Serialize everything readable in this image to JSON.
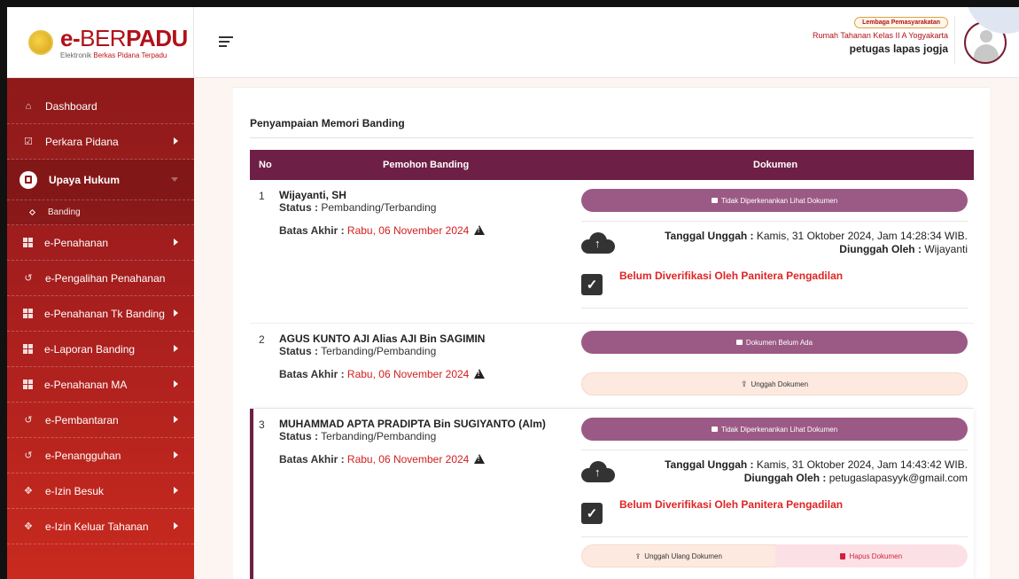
{
  "brand": {
    "name_e": "e-",
    "name_ber": "BER",
    "name_padu": "PADU",
    "subtitle_prefix": "Elektronik",
    "subtitle_red": "Berkas Pidana Terpadu"
  },
  "user": {
    "badge": "Lembaga Pemasyarakatan",
    "org": "Rumah Tahanan Kelas II A Yogyakarta",
    "name": "petugas lapas jogja"
  },
  "sidebar": {
    "items": [
      {
        "label": "Dashboard"
      },
      {
        "label": "Perkara Pidana"
      },
      {
        "label": "Upaya Hukum"
      },
      {
        "label": "Banding"
      },
      {
        "label": "e-Penahanan"
      },
      {
        "label": "e-Pengalihan Penahanan"
      },
      {
        "label": "e-Penahanan Tk Banding"
      },
      {
        "label": "e-Laporan Banding"
      },
      {
        "label": "e-Penahanan MA"
      },
      {
        "label": "e-Pembantaran"
      },
      {
        "label": "e-Penangguhan"
      },
      {
        "label": "e-Izin Besuk"
      },
      {
        "label": "e-Izin Keluar Tahanan"
      }
    ]
  },
  "main": {
    "title": "Penyampaian Memori Banding",
    "table": {
      "headers": [
        "No",
        "Pemohon Banding",
        "Dokumen"
      ],
      "status_label": "Status :",
      "batas_label": "Batas Akhir :",
      "rows": [
        {
          "no": "1",
          "name": "Wijayanti, SH",
          "status": "Pembanding/Terbanding",
          "batas": "Rabu, 06 November 2024",
          "doc_button": "Tidak Diperkenankan Lihat Dokumen",
          "upload_label": "Tanggal Unggah :",
          "upload_date": "Kamis, 31 Oktober 2024, Jam 14:28:34 WIB.",
          "uploader_label": "Diunggah Oleh :",
          "uploader": "Wijayanti",
          "verify": "Belum Diverifikasi Oleh Panitera Pengadilan"
        },
        {
          "no": "2",
          "name": "AGUS KUNTO AJI Alias AJI Bin SAGIMIN",
          "status": "Terbanding/Pembanding",
          "batas": "Rabu, 06 November 2024",
          "doc_button": "Dokumen Belum Ada",
          "upload_button": "Unggah Dokumen"
        },
        {
          "no": "3",
          "name": "MUHAMMAD APTA PRADIPTA Bin SUGIYANTO (Alm)",
          "status": "Terbanding/Pembanding",
          "batas": "Rabu, 06 November 2024",
          "doc_button": "Tidak Diperkenankan Lihat Dokumen",
          "upload_label": "Tanggal Unggah :",
          "upload_date": "Kamis, 31 Oktober 2024, Jam 14:43:42 WIB.",
          "uploader_label": "Diunggah Oleh :",
          "uploader": "petugaslapasyyk@gmail.com",
          "verify": "Belum Diverifikasi Oleh Panitera Pengadilan",
          "reupload_button": "Unggah Ulang Dokumen",
          "delete_button": "Hapus Dokumen"
        }
      ]
    }
  },
  "icons": {
    "hamburger": "menu-icon",
    "warning": "warning-icon",
    "cloud": "cloud-upload-icon",
    "check": "check-icon"
  },
  "colors": {
    "brand_red": "#b0121a",
    "table_header": "#6e1f45",
    "doc_button": "#9b5a85",
    "warning_red": "#d32020"
  }
}
